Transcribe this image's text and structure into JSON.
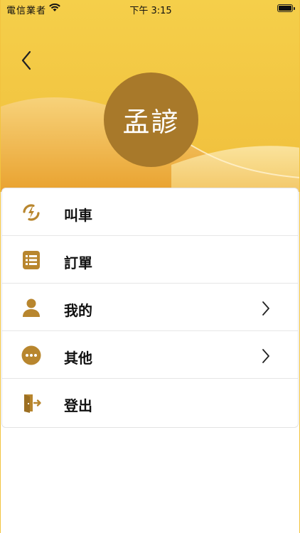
{
  "status_bar": {
    "carrier": "電信業者",
    "time": "下午 3:15"
  },
  "profile": {
    "name": "孟諺"
  },
  "menu": {
    "items": [
      {
        "label": "叫車",
        "icon": "lightning-swap-icon",
        "has_chevron": false
      },
      {
        "label": "訂單",
        "icon": "list-icon",
        "has_chevron": false
      },
      {
        "label": "我的",
        "icon": "person-icon",
        "has_chevron": true
      },
      {
        "label": "其他",
        "icon": "more-dots-icon",
        "has_chevron": true
      },
      {
        "label": "登出",
        "icon": "logout-icon",
        "has_chevron": false
      }
    ]
  },
  "colors": {
    "accent": "#B8862E",
    "header_top": "#F2C33F",
    "header_wave": "#E8A935",
    "avatar": "#A8792A"
  }
}
